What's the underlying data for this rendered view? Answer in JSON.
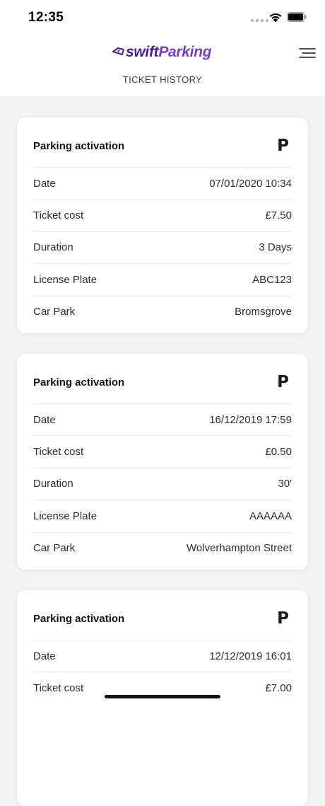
{
  "status_bar": {
    "time": "12:35"
  },
  "header": {
    "logo_primary": "swift",
    "logo_secondary": "Parking",
    "subtitle": "TICKET HISTORY",
    "brand_color": "#4b1d86"
  },
  "tickets": [
    {
      "title": "Parking activation",
      "icon": "P",
      "rows": [
        {
          "label": "Date",
          "value": "07/01/2020 10:34"
        },
        {
          "label": "Ticket cost",
          "value": "£7.50"
        },
        {
          "label": "Duration",
          "value": "3 Days"
        },
        {
          "label": "License Plate",
          "value": "ABC123"
        },
        {
          "label": "Car Park",
          "value": "Bromsgrove"
        }
      ]
    },
    {
      "title": "Parking activation",
      "icon": "P",
      "rows": [
        {
          "label": "Date",
          "value": "16/12/2019 17:59"
        },
        {
          "label": "Ticket cost",
          "value": "£0.50"
        },
        {
          "label": "Duration",
          "value": "30'"
        },
        {
          "label": "License Plate",
          "value": "AAAAAA"
        },
        {
          "label": "Car Park",
          "value": "Wolverhampton Street"
        }
      ]
    },
    {
      "title": "Parking activation",
      "icon": "P",
      "rows": [
        {
          "label": "Date",
          "value": "12/12/2019 16:01"
        },
        {
          "label": "Ticket cost",
          "value": "£7.00"
        }
      ]
    }
  ]
}
